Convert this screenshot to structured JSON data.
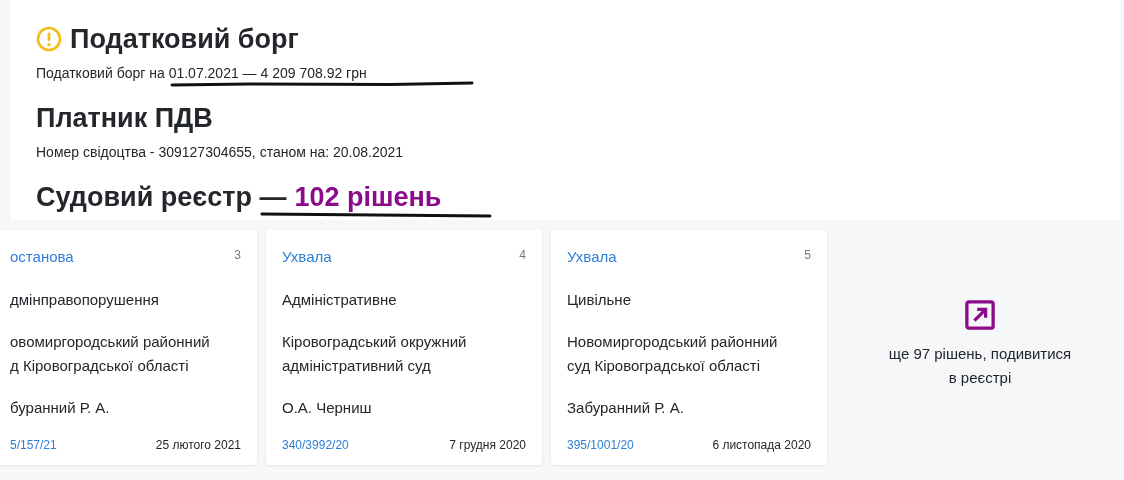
{
  "sections": [
    {
      "kind": "alert",
      "title": "Податковий борг",
      "text": "Податковий борг на 01.07.2021 — 4 209 708.92 грн"
    },
    {
      "kind": "plain",
      "title": "Платник ПДВ",
      "text": "Номер свідоцтва - 309127304655, станом на: 20.08.2021"
    }
  ],
  "registry": {
    "title": "Судовий реєстр —",
    "count": "102 рішень"
  },
  "cards": [
    {
      "cut_left": true,
      "type": "останова",
      "number": "3",
      "category": "дмінправопорушення",
      "court": "овомиргородський районний д Кіровоградської області",
      "judge": "буранний Р. А.",
      "case_no": "5/157/21",
      "date": "25 лютого 2021"
    },
    {
      "cut_left": false,
      "type": "Ухвала",
      "number": "4",
      "category": "Адміністративне",
      "court": "Кіровоградський окружний адміністративний суд",
      "judge": "О.А. Черниш",
      "case_no": "340/3992/20",
      "date": "7 грудня 2020"
    },
    {
      "cut_left": false,
      "type": "Ухвала",
      "number": "5",
      "category": "Цивільне",
      "court": "Новомиргородський районний суд Кіровоградської області",
      "judge": "Забуранний Р. А.",
      "case_no": "395/1001/20",
      "date": "6 листопада 2020"
    }
  ],
  "more": {
    "text": "ще 97 рішень, подивитися в реєстрі"
  }
}
